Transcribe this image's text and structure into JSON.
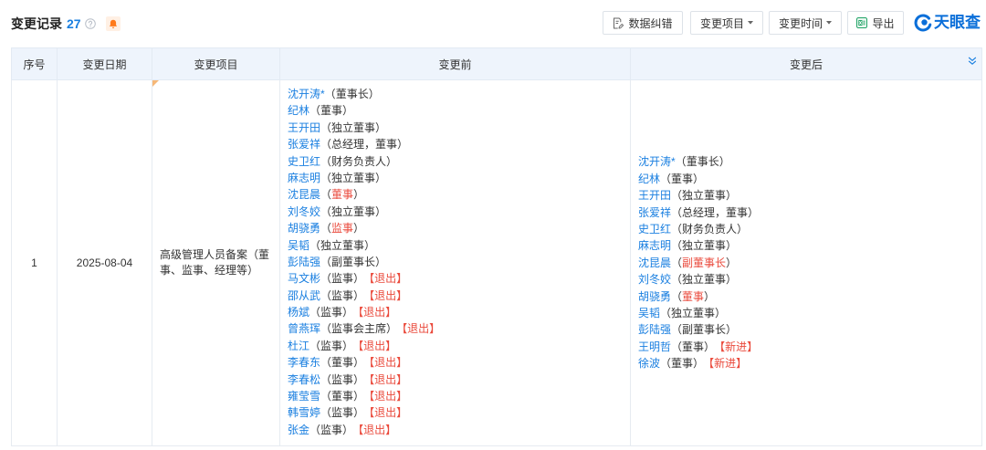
{
  "toolbar": {
    "title": "变更记录",
    "count": "27",
    "help_icon": "question-circle-icon",
    "notify_icon": "bell-icon",
    "buttons": {
      "report_error": {
        "label": "数据纠错",
        "icon": "edit-document-icon"
      },
      "filter_item": {
        "label": "变更项目",
        "icon": "caret-down-icon"
      },
      "filter_time": {
        "label": "变更时间",
        "icon": "caret-down-icon"
      },
      "export": {
        "label": "导出",
        "icon": "excel-icon"
      }
    },
    "logo": {
      "text": "天眼查",
      "icon": "tianyancha-logo-icon"
    }
  },
  "table": {
    "columns": [
      "序号",
      "变更日期",
      "变更项目",
      "变更前",
      "变更后"
    ],
    "expand_icon": "double-chevron-down-icon",
    "punctuation": {
      "open": "（",
      "close": "）"
    },
    "rows": [
      {
        "index": "1",
        "date": "2025-08-04",
        "item": "高级管理人员备案（董事、监事、经理等）",
        "before": [
          {
            "name": "沈开涛*",
            "role": "董事长"
          },
          {
            "name": "纪林",
            "role": "董事"
          },
          {
            "name": "王开田",
            "role": "独立董事"
          },
          {
            "name": "张爱祥",
            "role": "总经理，董事"
          },
          {
            "name": "史卫红",
            "role": "财务负责人"
          },
          {
            "name": "麻志明",
            "role": "独立董事"
          },
          {
            "name": "沈昆晨",
            "role": "董事",
            "role_changed": true
          },
          {
            "name": "刘冬姣",
            "role": "独立董事"
          },
          {
            "name": "胡骁勇",
            "role": "监事",
            "role_changed": true
          },
          {
            "name": "吴韬",
            "role": "独立董事"
          },
          {
            "name": "彭陆强",
            "role": "副董事长"
          },
          {
            "name": "马文彬",
            "role": "监事",
            "tag": "【退出】"
          },
          {
            "name": "邵从武",
            "role": "监事",
            "tag": "【退出】"
          },
          {
            "name": "杨斌",
            "role": "监事",
            "tag": "【退出】"
          },
          {
            "name": "曾燕珲",
            "role": "监事会主席",
            "tag": "【退出】"
          },
          {
            "name": "杜江",
            "role": "监事",
            "tag": "【退出】"
          },
          {
            "name": "李春东",
            "role": "董事",
            "tag": "【退出】"
          },
          {
            "name": "李春松",
            "role": "监事",
            "tag": "【退出】"
          },
          {
            "name": "雍莹雪",
            "role": "董事",
            "tag": "【退出】"
          },
          {
            "name": "韩雪婷",
            "role": "监事",
            "tag": "【退出】"
          },
          {
            "name": "张金",
            "role": "监事",
            "tag": "【退出】"
          }
        ],
        "after": [
          {
            "name": "沈开涛*",
            "role": "董事长"
          },
          {
            "name": "纪林",
            "role": "董事"
          },
          {
            "name": "王开田",
            "role": "独立董事"
          },
          {
            "name": "张爱祥",
            "role": "总经理，董事"
          },
          {
            "name": "史卫红",
            "role": "财务负责人"
          },
          {
            "name": "麻志明",
            "role": "独立董事"
          },
          {
            "name": "沈昆晨",
            "role": "副董事长",
            "role_changed": true
          },
          {
            "name": "刘冬姣",
            "role": "独立董事"
          },
          {
            "name": "胡骁勇",
            "role": "董事",
            "role_changed": true
          },
          {
            "name": "吴韬",
            "role": "独立董事"
          },
          {
            "name": "彭陆强",
            "role": "副董事长"
          },
          {
            "name": "王明哲",
            "role": "董事",
            "tag": "【新进】"
          },
          {
            "name": "徐波",
            "role": "董事",
            "tag": "【新进】"
          }
        ]
      }
    ]
  },
  "colors": {
    "link": "#1a7fe0",
    "highlight_red": "#ea4a3c",
    "header_bg": "#eef4fc",
    "border": "#e6ebf1",
    "text": "#333333",
    "accent_orange": "#ff7a1a",
    "excel_green": "#21a366",
    "logo_blue": "#0b6fd9"
  }
}
